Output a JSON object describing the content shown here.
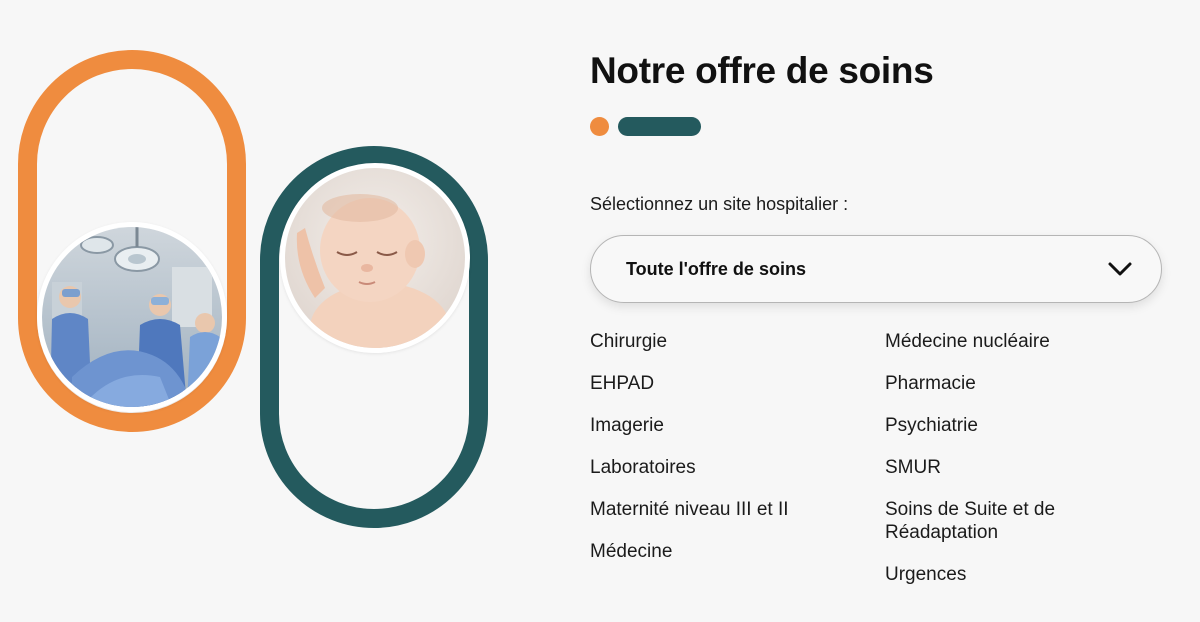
{
  "illustration": {
    "images": [
      {
        "subject": "surgical team in operating room"
      },
      {
        "subject": "sleeping newborn baby"
      }
    ],
    "colors": {
      "orange": "#ef8c3f",
      "teal": "#245a5e"
    }
  },
  "header": {
    "title": "Notre offre de soins"
  },
  "selector": {
    "label": "Sélectionnez un site hospitalier :",
    "selected_value": "Toute l'offre de soins",
    "icon": "chevron-down-icon"
  },
  "care_offer": {
    "column_1": [
      {
        "label": "Chirurgie"
      },
      {
        "label": "EHPAD"
      },
      {
        "label": "Imagerie"
      },
      {
        "label": "Laboratoires"
      },
      {
        "label": "Maternité niveau III et II"
      },
      {
        "label": "Médecine"
      }
    ],
    "column_2": [
      {
        "label": "Médecine nucléaire"
      },
      {
        "label": "Pharmacie"
      },
      {
        "label": "Psychiatrie"
      },
      {
        "label": "SMUR"
      },
      {
        "label": "Soins de Suite et de Réadaptation"
      },
      {
        "label": "Urgences"
      }
    ]
  }
}
